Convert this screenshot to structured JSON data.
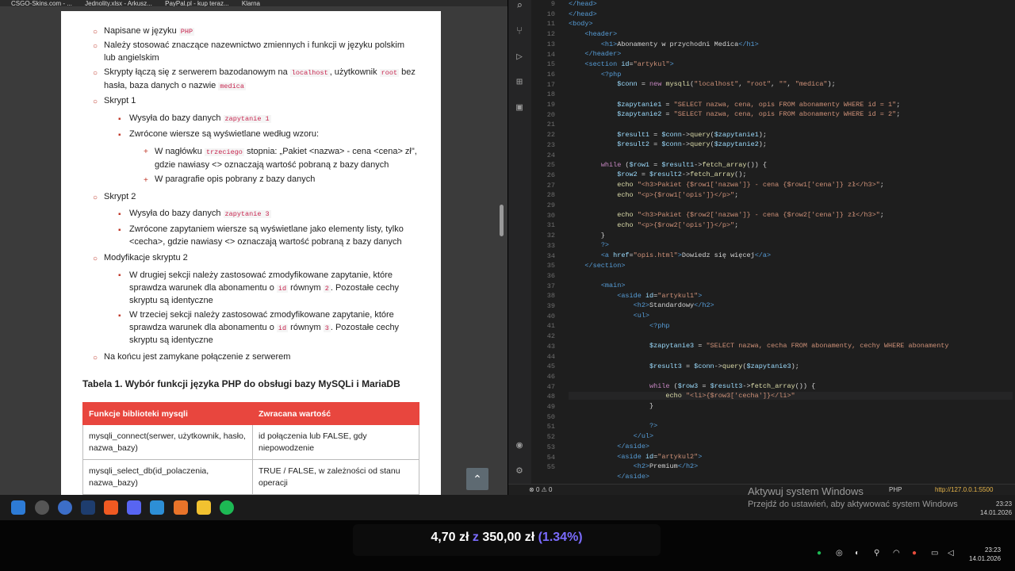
{
  "browser_tabs": [
    "CSGO-Skins.com - ...",
    "Jednolity.xlsx - Arkusz...",
    "PayPal.pl - kup teraz...",
    "Klarna"
  ],
  "doc": {
    "items": [
      {
        "pre": "Napisane w języku ",
        "code": "PHP",
        "post": ""
      },
      {
        "pre": "Należy stosować znaczące nazewnictwo zmiennych i funkcji w języku polskim",
        "post": "lub angielskim"
      },
      {
        "pre": "Skrypty łączą się z serwerem bazodanowym na ",
        "code": "localhost",
        "mid": ", użytkownik ",
        "code2": "root",
        "post": " bez",
        "line2": "hasła, baza danych o nazwie ",
        "code3": "medica"
      },
      {
        "pre": "Skrypt 1"
      },
      {
        "pre": "Wysyła do bazy danych ",
        "code": "zapytanie 1"
      },
      {
        "pre": "Zwrócone wiersze są wyświetlane według wzoru:"
      },
      {
        "pre": "W nagłówku ",
        "code": "trzeciego",
        "post": " stopnia: „Pakiet <nazwa> - cena <cena> zł\",",
        "line2": "gdzie nawiasy <> oznaczają wartość pobraną z bazy danych"
      },
      {
        "pre": "W paragrafie opis pobrany z bazy danych"
      },
      {
        "pre": "Skrypt 2"
      },
      {
        "pre": "Wysyła do bazy danych ",
        "code": "zapytanie 3"
      },
      {
        "pre": "Zwrócone zapytaniem wiersze są wyświetlane jako elementy listy, tylko",
        "line2": "<cecha>, gdzie nawiasy <> oznaczają wartość pobraną z bazy danych"
      },
      {
        "pre": "Modyfikacje skryptu 2"
      },
      {
        "pre": "W drugiej sekcji należy zastosować zmodyfikowane zapytanie, które",
        "line2a": "sprawdza warunek dla abonamentu o ",
        "code": "id",
        "mid": " równym ",
        "code2": "2",
        "post": ". Pozostałe cechy",
        "line3": "skryptu są identyczne"
      },
      {
        "pre": "W trzeciej sekcji należy zastosować zmodyfikowane zapytanie, które",
        "line2a": "sprawdza warunek dla abonamentu o ",
        "code": "id",
        "mid": " równym ",
        "code2": "3",
        "post": ". Pozostałe cechy",
        "line3": "skryptu są identyczne"
      },
      {
        "pre": "Na końcu jest zamykane połączenie z serwerem"
      }
    ],
    "table_title": "Tabela 1. Wybór funkcji języka PHP do obsługi bazy MySQLi i MariaDB",
    "table_headers": [
      "Funkcje biblioteki mysqli",
      "Zwracana wartość"
    ],
    "table_rows": [
      [
        "mysqli_connect(serwer, użytkownik, hasło, nazwa_bazy)",
        "id połączenia lub FALSE, gdy niepowodzenie"
      ],
      [
        "mysqli_select_db(id_polaczenia, nazwa_bazy)",
        "TRUE / FALSE, w zależności od stanu operacji"
      ]
    ],
    "scroll_top_icon": "chevron-up-icon"
  },
  "editor": {
    "line_numbers": [
      "9",
      "10",
      "11",
      "12",
      "13",
      "14",
      "15",
      "16",
      "17",
      "18",
      "19",
      "20",
      "21",
      "22",
      "23",
      "24",
      "25",
      "26",
      "27",
      "28",
      "29",
      "30",
      "31",
      "32",
      "33",
      "34",
      "35",
      "36",
      "37",
      "38",
      "39",
      "40",
      "41",
      "42",
      "43",
      "44",
      "45",
      "46",
      "47",
      "48",
      "49",
      "50",
      "51",
      "52",
      "53",
      "54",
      "55"
    ],
    "status": {
      "errors": "0",
      "warnings": "0",
      "lang": "PHP",
      "server": "http://127.0.0.1:5500"
    }
  },
  "taskbar": {
    "time": "23:23",
    "date": "14.01.2026"
  },
  "watermark": {
    "title": "Aktywuj system Windows",
    "subtitle": "Przejdź do ustawień, aby aktywować system Windows"
  },
  "donation": {
    "current": "4,70 zł",
    "of": "z",
    "goal": "350,00 zł",
    "percent": "(1.34%)"
  },
  "tray": {
    "time": "23:23",
    "date": "14.01.2026"
  },
  "colors": {
    "table_header": "#e8463e",
    "percent": "#7b6cff",
    "of": "#7b6cff"
  }
}
